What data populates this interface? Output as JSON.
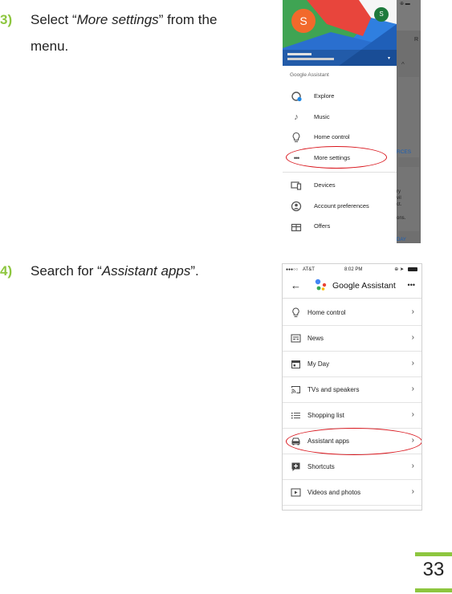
{
  "steps": [
    {
      "number": "3)",
      "text_before": "Select “",
      "emphasis": "More settings",
      "text_after": "” from the",
      "line2": "menu."
    },
    {
      "number": "4)",
      "text_before": "Search for “",
      "emphasis": "Assistant apps",
      "text_after": "”."
    }
  ],
  "screenshot1": {
    "avatar_letter": "S",
    "small_avatar_letter": "S",
    "section_label": "Google Assistant",
    "items": [
      {
        "label": "Explore",
        "icon": "compass-icon"
      },
      {
        "label": "Music",
        "icon": "music-note-icon"
      },
      {
        "label": "Home control",
        "icon": "lightbulb-icon"
      },
      {
        "label": "More settings",
        "icon": "more-dots-icon"
      },
      {
        "label": "Devices",
        "icon": "devices-icon"
      },
      {
        "label": "Account preferences",
        "icon": "account-icon"
      },
      {
        "label": "Offers",
        "icon": "gift-icon"
      }
    ],
    "bg_fragments": {
      "r": "R",
      "rces": "RCES",
      "ry": "ry",
      "vil": "vil",
      "ct": "ct.",
      "ons": "ons.",
      "day": "DAY"
    }
  },
  "screenshot2": {
    "status_carrier": "AT&T",
    "status_time": "8:02 PM",
    "title": "Google Assistant",
    "rows": [
      {
        "label": "Home control",
        "icon": "lightbulb-icon"
      },
      {
        "label": "News",
        "icon": "newspaper-icon"
      },
      {
        "label": "My Day",
        "icon": "calendar-icon"
      },
      {
        "label": "TVs and speakers",
        "icon": "cast-icon"
      },
      {
        "label": "Shopping list",
        "icon": "list-icon"
      },
      {
        "label": "Assistant apps",
        "icon": "car-icon"
      },
      {
        "label": "Shortcuts",
        "icon": "shortcut-icon"
      },
      {
        "label": "Videos and photos",
        "icon": "video-icon"
      }
    ]
  },
  "colors": {
    "accent_green": "#8dc63f",
    "highlight_red": "#d9141b"
  },
  "page_number": "33"
}
